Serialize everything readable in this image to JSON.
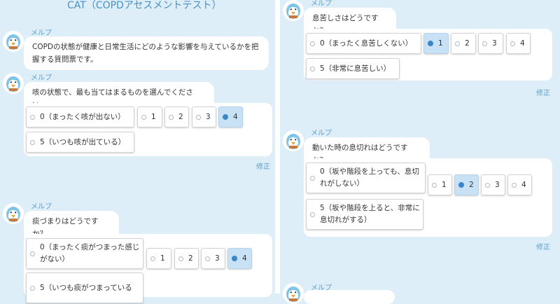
{
  "left": {
    "title": "CAT（COPDアセスメントテスト）",
    "messages": [
      {
        "sender": "メルプ",
        "text": "COPDの状態が健康と日常生活にどのような影響を与えているかを把握する質問票です。"
      },
      {
        "sender": "メルプ",
        "text": "咳の状態で、最も当てはまるものを選んでください。",
        "options": [
          "0（まったく咳が出ない）",
          "1",
          "2",
          "3",
          "4",
          "5（いつも咳が出ている）"
        ],
        "selected": "4",
        "edit_label": "修正"
      },
      {
        "sender": "メルプ",
        "text": "痰づまりはどうですか？",
        "options": [
          "0（まったく痰がつまった感じがない）",
          "1",
          "2",
          "3",
          "4",
          "5（いつも痰がつまっている"
        ],
        "selected": "4"
      }
    ]
  },
  "right": {
    "messages": [
      {
        "sender": "メルプ",
        "text": "息苦しさはどうですか？",
        "options": [
          "0（まったく息苦しくない）",
          "1",
          "2",
          "3",
          "4",
          "5（非常に息苦しい）"
        ],
        "selected": "1",
        "edit_label": "修正"
      },
      {
        "sender": "メルプ",
        "text": "動いた時の息切れはどうですか？",
        "options": [
          "0（坂や階段を上っても、息切れがしない）",
          "1",
          "2",
          "3",
          "4",
          "5（坂や階段を上ると、非常に息切れがする）"
        ],
        "selected": "2",
        "edit_label": "修正"
      },
      {
        "sender": "メルプ"
      }
    ]
  },
  "icons": {
    "avatar": "penguin-avatar-icon",
    "radio": "radio-icon"
  },
  "colors": {
    "background": "#ddeef8",
    "accent": "#4a90c8",
    "selected_bg": "#c8e1f4",
    "radio_selected": "#3a86c6"
  }
}
